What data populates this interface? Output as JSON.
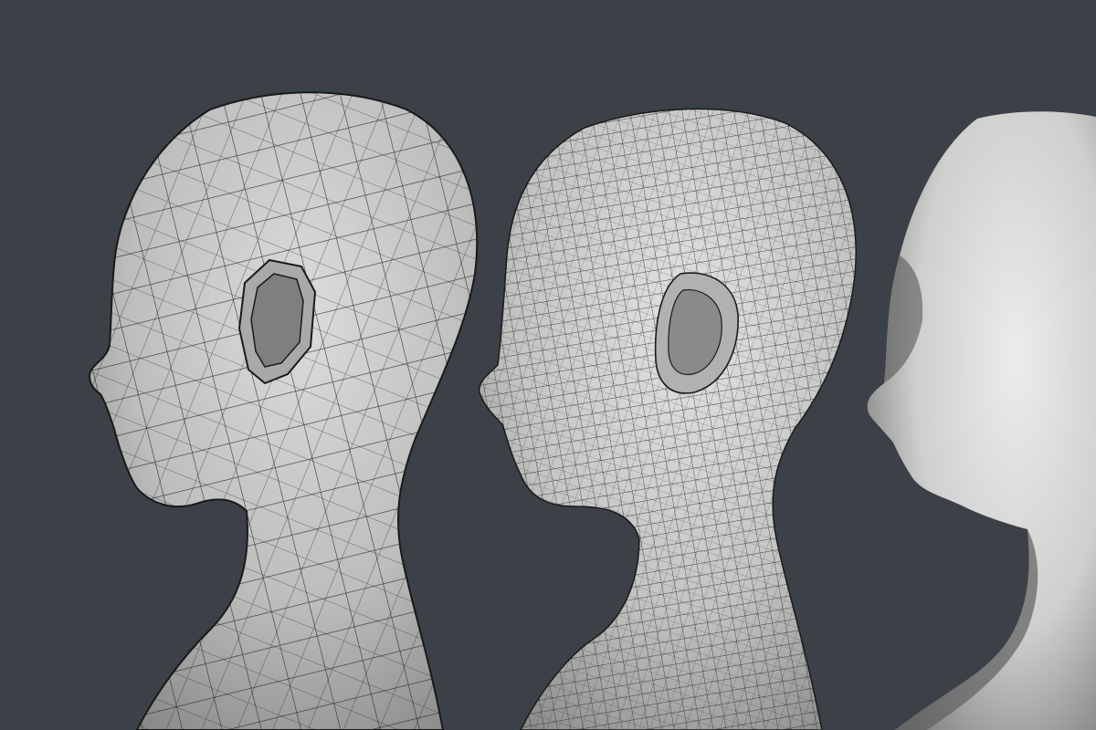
{
  "scene": {
    "background_color": "#3b4146",
    "subjects": [
      {
        "id": "low-poly-head",
        "kind": "wireframe-mesh",
        "mesh_density": "low",
        "surface_color": "#c9c9c9",
        "wire_color": "#1a1a1a"
      },
      {
        "id": "high-poly-head",
        "kind": "wireframe-mesh",
        "mesh_density": "high",
        "surface_color": "#cfcfcf",
        "wire_color": "#202020"
      },
      {
        "id": "smooth-shaded-head",
        "kind": "smooth-shaded",
        "surface_color": "#d6d6d6"
      }
    ]
  }
}
